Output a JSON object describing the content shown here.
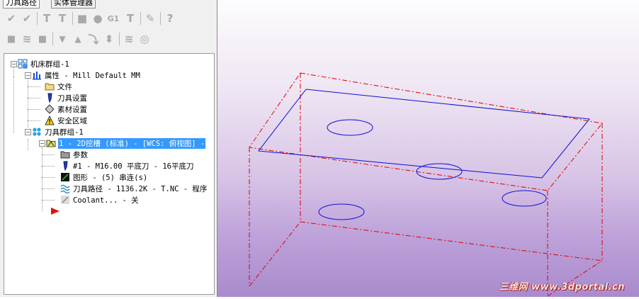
{
  "tabs": [
    "刀具路径",
    "实体管理器"
  ],
  "toolbar_row1": [
    {
      "icon": "check-all-icon",
      "glyph": "✔"
    },
    {
      "icon": "check-dirty-icon",
      "glyph": "✔"
    },
    {
      "icon": "toolpath-t-icon",
      "glyph": "T"
    },
    {
      "icon": "toolpath-tx-icon",
      "glyph": "T"
    },
    {
      "icon": "stop-icon",
      "glyph": "■"
    },
    {
      "icon": "shape-icon",
      "glyph": "●"
    },
    {
      "icon": "g1-icon",
      "glyph": "G1"
    },
    {
      "icon": "post-icon",
      "glyph": "T"
    },
    {
      "icon": "magic-icon",
      "glyph": "✎"
    },
    {
      "icon": "help-icon",
      "glyph": "?"
    }
  ],
  "toolbar_row2": [
    {
      "icon": "lock-icon",
      "glyph": "🔒"
    },
    {
      "icon": "wave-icon",
      "glyph": "≋"
    },
    {
      "icon": "lock2-icon",
      "glyph": "■"
    },
    {
      "icon": "arrow-down-icon",
      "glyph": "▼"
    },
    {
      "icon": "arrow-up-icon",
      "glyph": "▲"
    },
    {
      "icon": "insert-icon",
      "glyph": "⮣"
    },
    {
      "icon": "updown-icon",
      "glyph": "⬍"
    },
    {
      "icon": "wave-off-icon",
      "glyph": "≋"
    },
    {
      "icon": "target-icon",
      "glyph": "◎"
    }
  ],
  "tree": {
    "machine_group": "机床群组-1",
    "properties": "属性 - Mill Default MM",
    "files": "文件",
    "tool_settings": "刀具设置",
    "stock_settings": "素材设置",
    "safety_zone": "安全区域",
    "toolpath_group": "刀具群组-1",
    "operation": "1 - 2D挖槽 (标准) - [WCS: 俯视图] -",
    "parameters": "参数",
    "tool": "#1 - M16.00 平底刀 - 16平底刀",
    "geometry": "图形 - (5) 串连(s)",
    "toolpath": "刀具路径 - 1136.2K - T.NC - 程序",
    "coolant": "Coolant... - 关"
  },
  "watermark": "三维网 www.3dportal.cn",
  "colors": {
    "stock_box": "#e00000",
    "part": "#1010d0",
    "selection": "#3399ff"
  }
}
